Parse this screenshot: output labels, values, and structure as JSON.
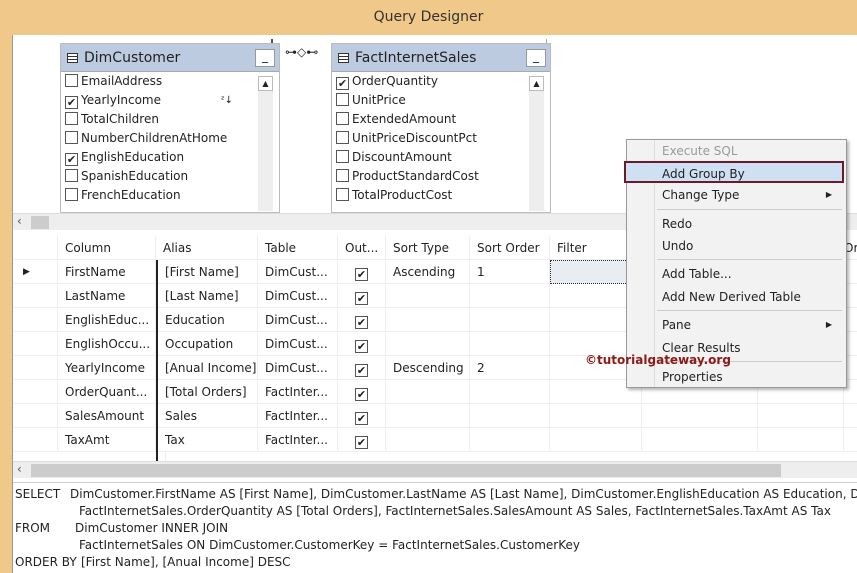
{
  "window": {
    "title": "Query Designer"
  },
  "diagram": {
    "tables": [
      {
        "name": "DimCustomer",
        "columns": [
          {
            "name": "EmailAddress",
            "checked": false
          },
          {
            "name": "YearlyIncome",
            "checked": true,
            "sort_icon": "sort-desc-icon"
          },
          {
            "name": "TotalChildren",
            "checked": false
          },
          {
            "name": "NumberChildrenAtHome",
            "checked": false
          },
          {
            "name": "EnglishEducation",
            "checked": true
          },
          {
            "name": "SpanishEducation",
            "checked": false
          },
          {
            "name": "FrenchEducation",
            "checked": false
          }
        ]
      },
      {
        "name": "FactInternetSales",
        "columns": [
          {
            "name": "OrderQuantity",
            "checked": true
          },
          {
            "name": "UnitPrice",
            "checked": false
          },
          {
            "name": "ExtendedAmount",
            "checked": false
          },
          {
            "name": "UnitPriceDiscountPct",
            "checked": false
          },
          {
            "name": "DiscountAmount",
            "checked": false
          },
          {
            "name": "ProductStandardCost",
            "checked": false
          },
          {
            "name": "TotalProductCost",
            "checked": false
          }
        ]
      }
    ]
  },
  "grid": {
    "headers": [
      "Column",
      "Alias",
      "Table",
      "Out...",
      "Sort Type",
      "Sort Order",
      "Filter",
      "Or"
    ],
    "rows": [
      {
        "column": "FirstName",
        "alias": "[First Name]",
        "table": "DimCust...",
        "output": true,
        "sort_type": "Ascending",
        "sort_order": "1"
      },
      {
        "column": "LastName",
        "alias": "[Last Name]",
        "table": "DimCust...",
        "output": true,
        "sort_type": "",
        "sort_order": ""
      },
      {
        "column": "EnglishEduc...",
        "alias": "Education",
        "table": "DimCust...",
        "output": true,
        "sort_type": "",
        "sort_order": ""
      },
      {
        "column": "EnglishOccu...",
        "alias": "Occupation",
        "table": "DimCust...",
        "output": true,
        "sort_type": "",
        "sort_order": ""
      },
      {
        "column": "YearlyIncome",
        "alias": "[Anual Income]",
        "table": "DimCust...",
        "output": true,
        "sort_type": "Descending",
        "sort_order": "2"
      },
      {
        "column": "OrderQuant...",
        "alias": "[Total Orders]",
        "table": "FactInter...",
        "output": true,
        "sort_type": "",
        "sort_order": ""
      },
      {
        "column": "SalesAmount",
        "alias": "Sales",
        "table": "FactInter...",
        "output": true,
        "sort_type": "",
        "sort_order": ""
      },
      {
        "column": "TaxAmt",
        "alias": "Tax",
        "table": "FactInter...",
        "output": true,
        "sort_type": "",
        "sort_order": ""
      }
    ]
  },
  "sql": {
    "lines": [
      {
        "kw": "SELECT",
        "text": "DimCustomer.FirstName AS [First Name], DimCustomer.LastName AS [Last Name], DimCustomer.EnglishEducation AS Education, DimCu"
      },
      {
        "kw": "",
        "text": "FactInternetSales.OrderQuantity AS [Total Orders], FactInternetSales.SalesAmount AS Sales, FactInternetSales.TaxAmt AS Tax"
      },
      {
        "kw": "FROM",
        "text": "DimCustomer INNER JOIN"
      },
      {
        "kw": "",
        "text": "FactInternetSales ON DimCustomer.CustomerKey = FactInternetSales.CustomerKey"
      },
      {
        "kw": "ORDER BY",
        "text": "[First Name], [Anual Income] DESC"
      }
    ]
  },
  "context_menu": {
    "items": [
      "Execute SQL",
      "Add Group By",
      "Change Type",
      "Redo",
      "Undo",
      "Add Table...",
      "Add New Derived Table",
      "Pane",
      "Clear Results",
      "Properties"
    ],
    "highlight_color": "#6b1a2a"
  },
  "watermark": "©tutorialgateway.org"
}
